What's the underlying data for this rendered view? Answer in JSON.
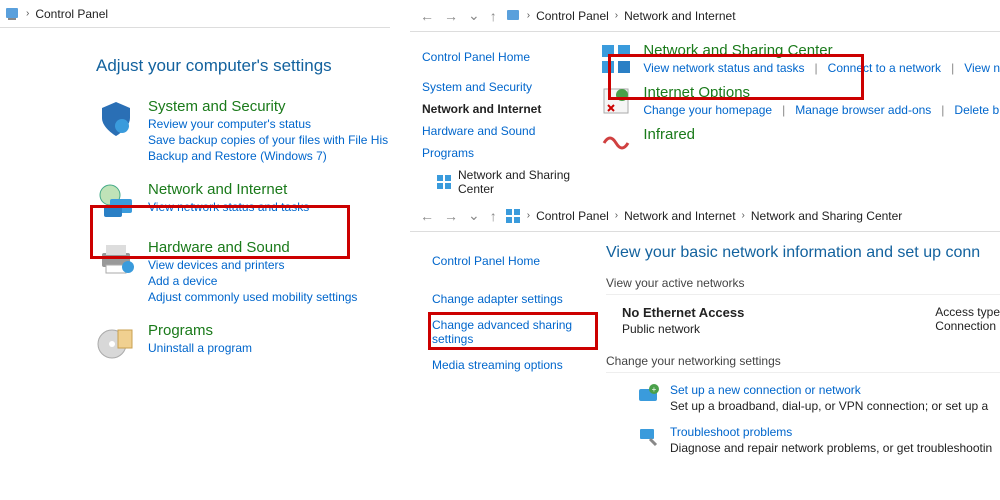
{
  "left": {
    "breadcrumb": "Control Panel",
    "heading": "Adjust your computer's settings",
    "cats": [
      {
        "title": "System and Security",
        "links": [
          "Review your computer's status",
          "Save backup copies of your files with File His",
          "Backup and Restore (Windows 7)"
        ]
      },
      {
        "title": "Network and Internet",
        "links": [
          "View network status and tasks"
        ]
      },
      {
        "title": "Hardware and Sound",
        "links": [
          "View devices and printers",
          "Add a device",
          "Adjust commonly used mobility settings"
        ]
      },
      {
        "title": "Programs",
        "links": [
          "Uninstall a program"
        ]
      }
    ]
  },
  "tr": {
    "crumbs": [
      "Control Panel",
      "Network and Internet"
    ],
    "side": {
      "home": "Control Panel Home",
      "items": [
        "System and Security",
        "Network and Internet",
        "Hardware and Sound",
        "Programs"
      ],
      "sub": "Network and Sharing Center"
    },
    "main": [
      {
        "title": "Network and Sharing Center",
        "links": [
          "View network status and tasks",
          "Connect to a network",
          "View n"
        ]
      },
      {
        "title": "Internet Options",
        "links": [
          "Change your homepage",
          "Manage browser add-ons",
          "Delete b"
        ]
      },
      {
        "title": "Infrared",
        "links": []
      }
    ]
  },
  "br": {
    "crumbs": [
      "Control Panel",
      "Network and Internet",
      "Network and Sharing Center"
    ],
    "side": {
      "home": "Control Panel Home",
      "adapter": "Change adapter settings",
      "advanced": "Change advanced sharing settings",
      "media": "Media streaming options"
    },
    "title": "View your basic network information and set up conn",
    "active_label": "View your active networks",
    "net": {
      "name": "No Ethernet Access",
      "type": "Public network",
      "r1": "Access type",
      "r2": "Connection"
    },
    "change_label": "Change your networking settings",
    "items": [
      {
        "title": "Set up a new connection or network",
        "desc": "Set up a broadband, dial-up, or VPN connection; or set up a"
      },
      {
        "title": "Troubleshoot problems",
        "desc": "Diagnose and repair network problems, or get troubleshootin"
      }
    ]
  }
}
